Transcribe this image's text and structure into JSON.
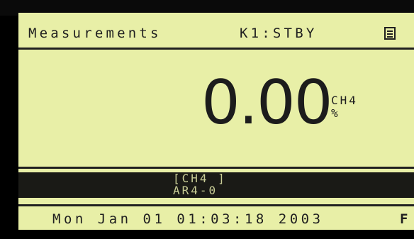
{
  "header": {
    "title": "Measurements",
    "status": "K1:STBY",
    "menu_icon": "list-menu-icon"
  },
  "reading": {
    "value": "0.00",
    "gas": "CH4",
    "unit": "%"
  },
  "sensor_band": {
    "line1": "[CH4 ]",
    "line2": "AR4-0"
  },
  "footer": {
    "datetime": "Mon Jan 01 01:03:18 2003",
    "flag": "F"
  },
  "colors": {
    "screen_background": "#e8efa7",
    "text": "#202020",
    "band_background": "#1a1a16",
    "band_text": "#c9cd96"
  }
}
